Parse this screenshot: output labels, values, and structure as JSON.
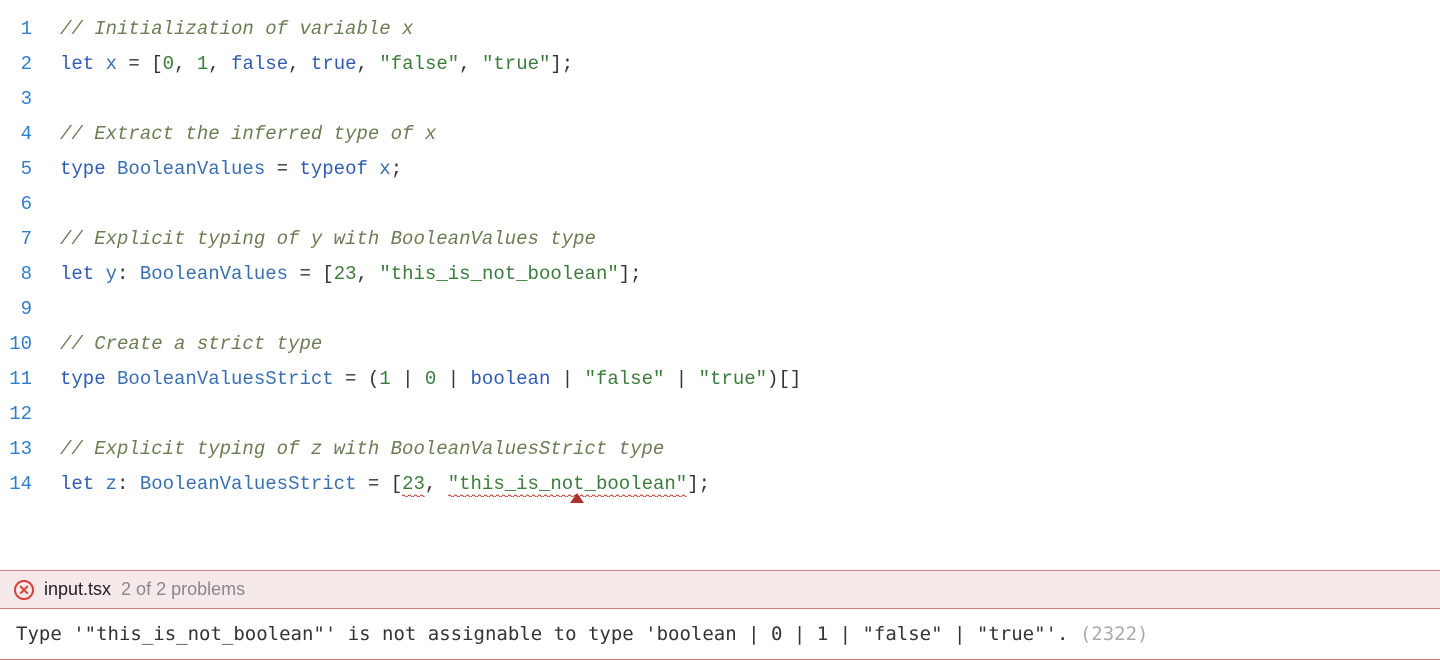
{
  "problems": {
    "filename": "input.tsx",
    "count_text": "2 of 2 problems"
  },
  "error": {
    "message": "Type '\"this_is_not_boolean\"' is not assignable to type 'boolean | 0 | 1 | \"false\" | \"true\"'.",
    "code": "(2322)"
  },
  "lines": {
    "l1": {
      "num": "1",
      "comment": "// Initialization of variable x"
    },
    "l2": {
      "num": "2",
      "let": "let",
      "x": "x",
      "eq": " = ",
      "ob": "[",
      "n0": "0",
      "c1": ", ",
      "n1": "1",
      "c2": ", ",
      "bf": "false",
      "c3": ", ",
      "bt": "true",
      "c4": ", ",
      "sf": "\"false\"",
      "c5": ", ",
      "st": "\"true\"",
      "cb": "];"
    },
    "l3": {
      "num": "3"
    },
    "l4": {
      "num": "4",
      "comment": "// Extract the inferred type of x"
    },
    "l5": {
      "num": "5",
      "type": "type",
      "sp": " ",
      "name": "BooleanValues",
      "eq": " = ",
      "typeof": "typeof",
      "sp2": " ",
      "x": "x",
      "sc": ";"
    },
    "l6": {
      "num": "6"
    },
    "l7": {
      "num": "7",
      "comment": "// Explicit typing of y with BooleanValues type"
    },
    "l8": {
      "num": "8",
      "let": "let",
      "sp": " ",
      "y": "y",
      "colon": ": ",
      "type": "BooleanValues",
      "eq": " = ",
      "ob": "[",
      "n": "23",
      "c1": ", ",
      "s": "\"this_is_not_boolean\"",
      "cb": "];"
    },
    "l9": {
      "num": "9"
    },
    "l10": {
      "num": "10",
      "comment": "// Create a strict type"
    },
    "l11": {
      "num": "11",
      "type": "type",
      "sp": " ",
      "name": "BooleanValuesStrict",
      "eq": " = ",
      "op": "(",
      "n1": "1",
      "b1": " | ",
      "n0": "0",
      "b2": " | ",
      "bool": "boolean",
      "b3": " | ",
      "sf": "\"false\"",
      "b4": " | ",
      "st": "\"true\"",
      "cp": ")",
      "arr": "[]"
    },
    "l12": {
      "num": "12"
    },
    "l13": {
      "num": "13",
      "comment": "// Explicit typing of z with BooleanValuesStrict type"
    },
    "l14": {
      "num": "14",
      "let": "let",
      "sp": " ",
      "z": "z",
      "colon": ": ",
      "type": "BooleanValuesStrict",
      "eq": " = ",
      "ob": "[",
      "n": "23",
      "c1": ", ",
      "s": "\"this_is_not_boolean\"",
      "cb": "];"
    }
  }
}
